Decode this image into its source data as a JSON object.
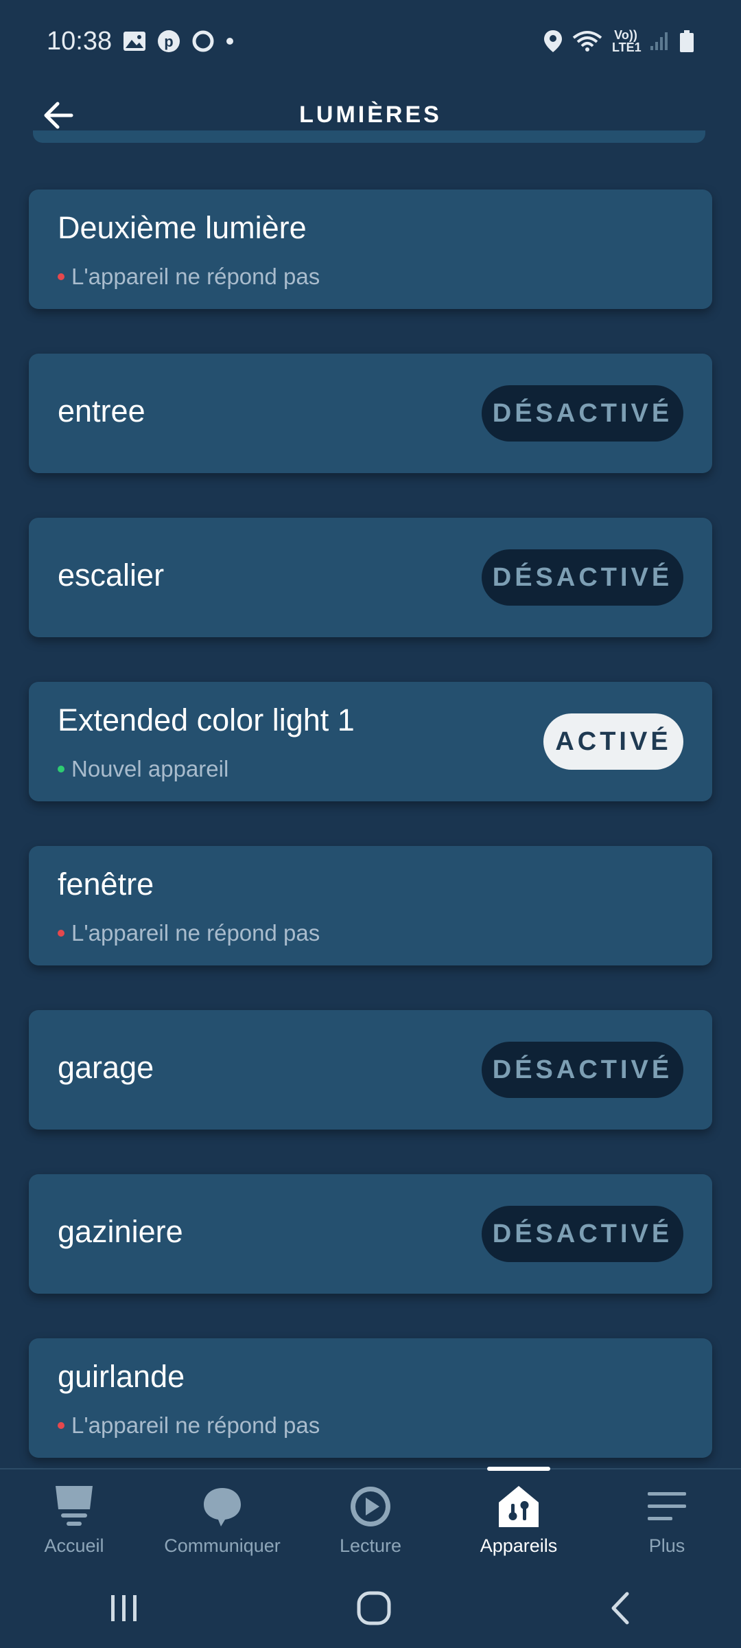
{
  "status_bar": {
    "time": "10:38",
    "network": "Vo)) LTE1",
    "icons": [
      "gallery-icon",
      "pinterest-icon",
      "circle-app-icon",
      "notification-dot",
      "location-icon",
      "wifi-icon",
      "signal-icon",
      "battery-icon"
    ]
  },
  "header": {
    "title": "LUMIÈRES",
    "back_icon": "arrow-left-icon"
  },
  "devices": [
    {
      "name": "Deuxième lumière",
      "status": "L'appareil ne répond pas",
      "status_color": "#e5484d",
      "toggle": null
    },
    {
      "name": "entree",
      "status": null,
      "toggle": "DÉSACTIVÉ",
      "toggle_state": "off"
    },
    {
      "name": "escalier",
      "status": null,
      "toggle": "DÉSACTIVÉ",
      "toggle_state": "off"
    },
    {
      "name": "Extended color light 1",
      "status": "Nouvel appareil",
      "status_color": "#2ecc71",
      "toggle": "ACTIVÉ",
      "toggle_state": "on"
    },
    {
      "name": "fenêtre",
      "status": "L'appareil ne répond pas",
      "status_color": "#e5484d",
      "toggle": null
    },
    {
      "name": "garage",
      "status": null,
      "toggle": "DÉSACTIVÉ",
      "toggle_state": "off"
    },
    {
      "name": "gaziniere",
      "status": null,
      "toggle": "DÉSACTIVÉ",
      "toggle_state": "off"
    },
    {
      "name": "guirlande",
      "status": "L'appareil ne répond pas",
      "status_color": "#e5484d",
      "toggle": null
    }
  ],
  "bottom_nav": [
    {
      "label": "Accueil",
      "icon": "home-icon",
      "active": false
    },
    {
      "label": "Communiquer",
      "icon": "chat-bubble-icon",
      "active": false
    },
    {
      "label": "Lecture",
      "icon": "play-icon",
      "active": false
    },
    {
      "label": "Appareils",
      "icon": "devices-house-icon",
      "active": true
    },
    {
      "label": "Plus",
      "icon": "menu-icon",
      "active": false
    }
  ],
  "system_nav": [
    "recents-icon",
    "home-circle-icon",
    "back-chevron-icon"
  ],
  "colors": {
    "background": "#1a3550",
    "card": "#25506f",
    "toggle_off_bg": "#0e2236",
    "toggle_on_bg": "#eef1f3",
    "error_dot": "#e5484d",
    "new_dot": "#2ecc71"
  }
}
